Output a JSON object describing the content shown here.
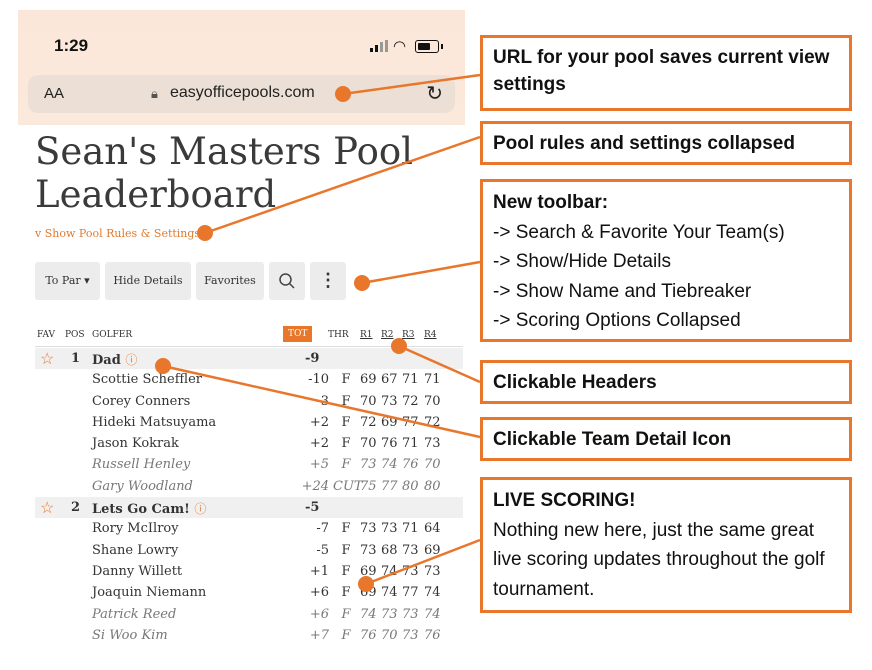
{
  "status_bar": {
    "time": "1:29"
  },
  "browser": {
    "text_size": "AA",
    "url": "easyofficepools.com"
  },
  "page": {
    "title_line1": "Sean's Masters Pool",
    "title_line2": "Leaderboard",
    "rules_toggle": "v Show Pool Rules & Settings"
  },
  "toolbar": {
    "to_par": "To Par",
    "hide_details": "Hide Details",
    "favorites": "Favorites",
    "search_icon": "search-icon",
    "more_icon": "more-vertical-icon"
  },
  "table": {
    "headers": {
      "fav": "FAV",
      "pos": "POS",
      "golfer": "GOLFER",
      "tot": "TOT",
      "thr": "THR",
      "r1": "R1",
      "r2": "R2",
      "r3": "R3",
      "r4": "R4"
    },
    "teams": [
      {
        "pos": "1",
        "name": "Dad",
        "tot": "-9",
        "golfers": [
          {
            "name": "Scottie Scheffler",
            "tot": "-10",
            "thr": "F",
            "r1": "69",
            "r2": "67",
            "r3": "71",
            "r4": "71",
            "counted": true
          },
          {
            "name": "Corey Conners",
            "tot": "-3",
            "thr": "F",
            "r1": "70",
            "r2": "73",
            "r3": "72",
            "r4": "70",
            "counted": true
          },
          {
            "name": "Hideki Matsuyama",
            "tot": "+2",
            "thr": "F",
            "r1": "72",
            "r2": "69",
            "r3": "77",
            "r4": "72",
            "counted": true
          },
          {
            "name": "Jason Kokrak",
            "tot": "+2",
            "thr": "F",
            "r1": "70",
            "r2": "76",
            "r3": "71",
            "r4": "73",
            "counted": true
          },
          {
            "name": "Russell Henley",
            "tot": "+5",
            "thr": "F",
            "r1": "73",
            "r2": "74",
            "r3": "76",
            "r4": "70",
            "counted": false
          },
          {
            "name": "Gary Woodland",
            "tot": "+24",
            "thr": "CUT",
            "r1": "75",
            "r2": "77",
            "r3": "80",
            "r4": "80",
            "counted": false
          }
        ]
      },
      {
        "pos": "2",
        "name": "Lets Go Cam!",
        "tot": "-5",
        "golfers": [
          {
            "name": "Rory McIlroy",
            "tot": "-7",
            "thr": "F",
            "r1": "73",
            "r2": "73",
            "r3": "71",
            "r4": "64",
            "counted": true
          },
          {
            "name": "Shane Lowry",
            "tot": "-5",
            "thr": "F",
            "r1": "73",
            "r2": "68",
            "r3": "73",
            "r4": "69",
            "counted": true
          },
          {
            "name": "Danny Willett",
            "tot": "+1",
            "thr": "F",
            "r1": "69",
            "r2": "74",
            "r3": "73",
            "r4": "73",
            "counted": true
          },
          {
            "name": "Joaquin Niemann",
            "tot": "+6",
            "thr": "F",
            "r1": "69",
            "r2": "74",
            "r3": "77",
            "r4": "74",
            "counted": true
          },
          {
            "name": "Patrick Reed",
            "tot": "+6",
            "thr": "F",
            "r1": "74",
            "r2": "73",
            "r3": "73",
            "r4": "74",
            "counted": false
          },
          {
            "name": "Si Woo Kim",
            "tot": "+7",
            "thr": "F",
            "r1": "76",
            "r2": "70",
            "r3": "73",
            "r4": "76",
            "counted": false
          }
        ]
      }
    ]
  },
  "callouts": {
    "url": "URL for your pool saves current view settings",
    "rules": "Pool rules and settings collapsed",
    "toolbar_title": "New toolbar:",
    "toolbar_items": [
      "-> Search & Favorite Your Team(s)",
      "-> Show/Hide Details",
      "-> Show Name and Tiebreaker",
      "-> Scoring Options Collapsed"
    ],
    "headers": "Clickable Headers",
    "team_icon": "Clickable Team Detail Icon",
    "live_title": "LIVE SCORING!",
    "live_body": "Nothing new here, just the same great live scoring updates throughout the golf tournament."
  },
  "colors": {
    "accent": "#e8762b",
    "title_text": "#3a3a3a",
    "row_highlight": "#f0f0f0"
  }
}
